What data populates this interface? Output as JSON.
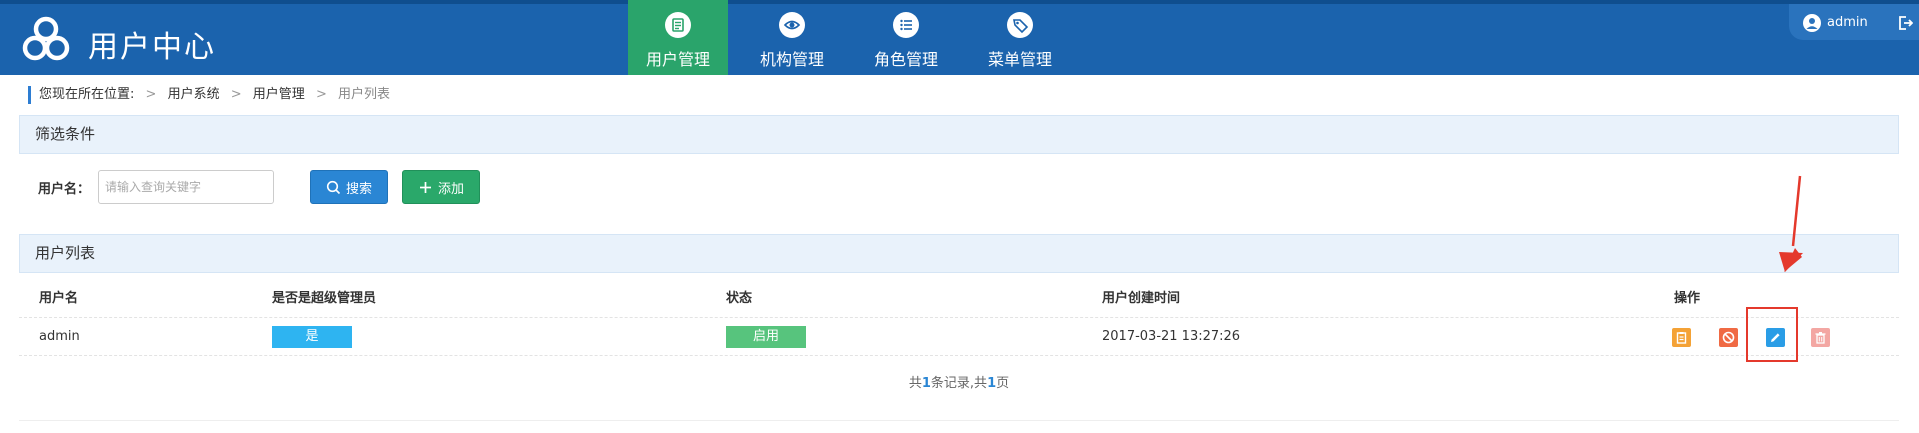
{
  "header": {
    "app_title": "用户中心",
    "nav": [
      {
        "label": "用户管理",
        "icon": "document-icon",
        "active": true
      },
      {
        "label": "机构管理",
        "icon": "eye-icon",
        "active": false
      },
      {
        "label": "角色管理",
        "icon": "list-icon",
        "active": false
      },
      {
        "label": "菜单管理",
        "icon": "tag-icon",
        "active": false
      }
    ],
    "user": {
      "name": "admin",
      "icon": "user-icon",
      "logout_icon": "logout-icon"
    }
  },
  "breadcrumb": {
    "prefix": "您现在所在位置:",
    "items": [
      "用户系统",
      "用户管理",
      "用户列表"
    ]
  },
  "filter": {
    "title": "筛选条件",
    "username_label": "用户名：",
    "username_placeholder": "请输入查询关键字",
    "search_label": "搜索",
    "add_label": "添加"
  },
  "user_list": {
    "title": "用户列表",
    "columns": [
      "用户名",
      "是否是超级管理员",
      "状态",
      "用户创建时间",
      "操作"
    ],
    "rows": [
      {
        "username": "admin",
        "is_super_admin": "是",
        "status": "启用",
        "created_at": "2017-03-21 13:27:26"
      }
    ],
    "actions": [
      "detail-icon",
      "disable-icon",
      "edit-icon",
      "delete-icon"
    ]
  },
  "pagination": {
    "total_prefix": "共",
    "total_records": "1",
    "records_mid": "条记录,共",
    "total_pages": "1",
    "pages_suffix": "页"
  },
  "colors": {
    "header_bg": "#1b63ad",
    "nav_active": "#2aa46b",
    "search_button": "#2a86d4",
    "add_button": "#2aa86a",
    "highlight": "#e4392c"
  }
}
